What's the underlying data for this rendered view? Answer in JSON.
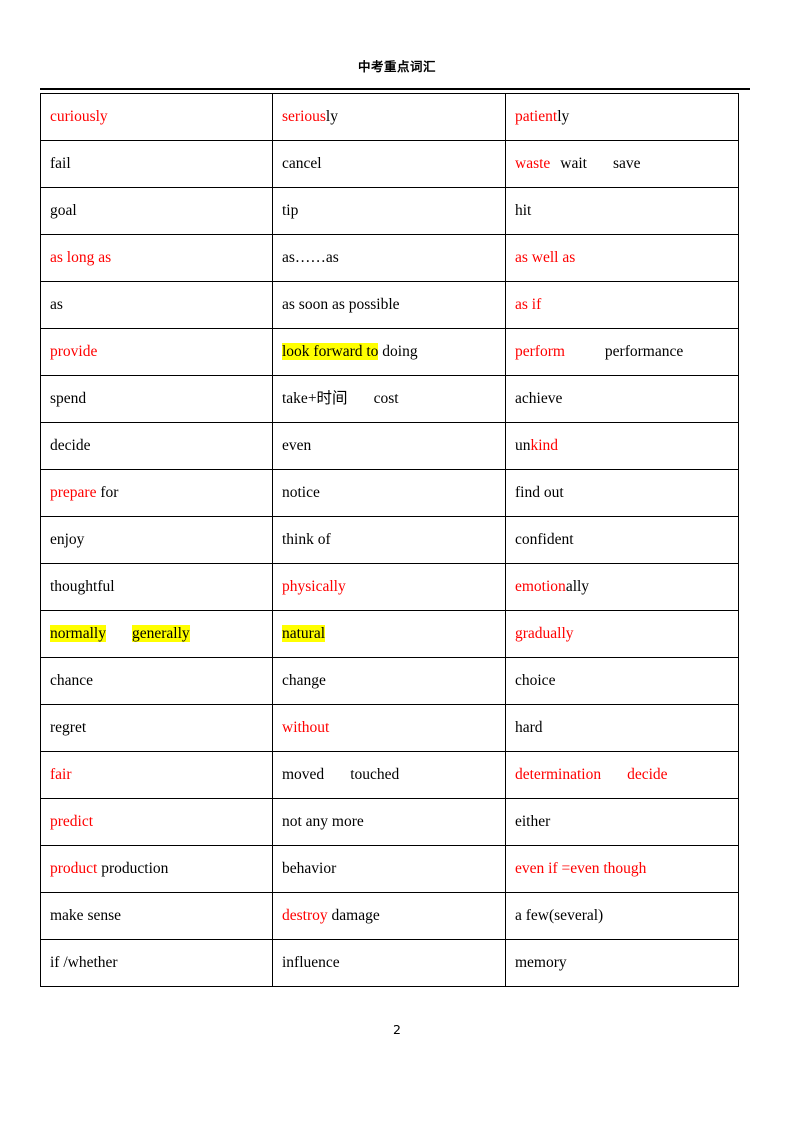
{
  "header": {
    "title": "中考重点词汇"
  },
  "footer": {
    "page_number": "2"
  },
  "colors": {
    "red": "#ff0000",
    "black": "#000000",
    "highlight": "#ffff00",
    "border": "#000000",
    "background": "#ffffff"
  },
  "table": {
    "columns": 3,
    "row_count": 19,
    "rows": [
      {
        "cells": [
          {
            "text": "curiously",
            "segments": [
              {
                "t": "curiously",
                "style": "red"
              }
            ]
          },
          {
            "text": "seriously",
            "segments": [
              {
                "t": "serious",
                "style": "red"
              },
              {
                "t": "ly",
                "style": "black"
              }
            ]
          },
          {
            "text": "patiently",
            "segments": [
              {
                "t": "patient",
                "style": "red"
              },
              {
                "t": "ly",
                "style": "black"
              }
            ]
          }
        ]
      },
      {
        "cells": [
          {
            "text": "fail",
            "segments": [
              {
                "t": "fail",
                "style": "black"
              }
            ]
          },
          {
            "text": "cancel",
            "segments": [
              {
                "t": "cancel",
                "style": "black"
              }
            ]
          },
          {
            "text": "waste  wait    save",
            "segments": [
              {
                "t": "waste",
                "style": "red"
              },
              {
                "t": "gap-sm",
                "style": "gap"
              },
              {
                "t": "wait",
                "style": "black"
              },
              {
                "t": "gap-md",
                "style": "gap"
              },
              {
                "t": "save",
                "style": "black"
              }
            ]
          }
        ]
      },
      {
        "cells": [
          {
            "text": "goal",
            "segments": [
              {
                "t": "goal",
                "style": "black"
              }
            ]
          },
          {
            "text": "tip",
            "segments": [
              {
                "t": "tip",
                "style": "black"
              }
            ]
          },
          {
            "text": "hit",
            "segments": [
              {
                "t": "hit",
                "style": "black"
              }
            ]
          }
        ]
      },
      {
        "cells": [
          {
            "text": "as long as",
            "segments": [
              {
                "t": "as long as",
                "style": "red"
              }
            ]
          },
          {
            "text": "as……as",
            "segments": [
              {
                "t": "as……as",
                "style": "black"
              }
            ]
          },
          {
            "text": "as well as",
            "segments": [
              {
                "t": "as well as",
                "style": "red"
              }
            ]
          }
        ]
      },
      {
        "cells": [
          {
            "text": "as",
            "segments": [
              {
                "t": "as",
                "style": "black"
              }
            ]
          },
          {
            "text": "as soon as possible",
            "segments": [
              {
                "t": "as soon as possible",
                "style": "black"
              }
            ]
          },
          {
            "text": "as if",
            "segments": [
              {
                "t": "as if",
                "style": "red"
              }
            ]
          }
        ]
      },
      {
        "cells": [
          {
            "text": "provide",
            "segments": [
              {
                "t": "provide",
                "style": "red"
              }
            ]
          },
          {
            "text": "look forward to doing",
            "segments": [
              {
                "t": "look forward to",
                "style": "hl"
              },
              {
                "t": " doing",
                "style": "black"
              }
            ]
          },
          {
            "text": "perform     performance",
            "segments": [
              {
                "t": "perform",
                "style": "red"
              },
              {
                "t": "gap-lg",
                "style": "gap"
              },
              {
                "t": "performance",
                "style": "black"
              }
            ]
          }
        ]
      },
      {
        "cells": [
          {
            "text": "spend",
            "segments": [
              {
                "t": "spend",
                "style": "black"
              }
            ]
          },
          {
            "text": "take+时间    cost",
            "segments": [
              {
                "t": "take+时间",
                "style": "black"
              },
              {
                "t": "gap-md",
                "style": "gap"
              },
              {
                "t": "cost",
                "style": "black"
              }
            ]
          },
          {
            "text": "achieve",
            "segments": [
              {
                "t": "achieve",
                "style": "black"
              }
            ]
          }
        ]
      },
      {
        "cells": [
          {
            "text": "decide",
            "segments": [
              {
                "t": "decide",
                "style": "black"
              }
            ]
          },
          {
            "text": "even",
            "segments": [
              {
                "t": "even",
                "style": "black"
              }
            ]
          },
          {
            "text": "unkind",
            "segments": [
              {
                "t": "un",
                "style": "black"
              },
              {
                "t": "kind",
                "style": "red"
              }
            ]
          }
        ]
      },
      {
        "cells": [
          {
            "text": "prepare for",
            "segments": [
              {
                "t": "prepare",
                "style": "red"
              },
              {
                "t": " for",
                "style": "black"
              }
            ]
          },
          {
            "text": "notice",
            "segments": [
              {
                "t": "notice",
                "style": "black"
              }
            ]
          },
          {
            "text": "find out",
            "segments": [
              {
                "t": "find out",
                "style": "black"
              }
            ]
          }
        ]
      },
      {
        "cells": [
          {
            "text": "enjoy",
            "segments": [
              {
                "t": "enjoy",
                "style": "black"
              }
            ]
          },
          {
            "text": "think of",
            "segments": [
              {
                "t": "think of",
                "style": "black"
              }
            ]
          },
          {
            "text": "confident",
            "segments": [
              {
                "t": "confident",
                "style": "black"
              }
            ]
          }
        ]
      },
      {
        "cells": [
          {
            "text": "thoughtful",
            "segments": [
              {
                "t": "thoughtful",
                "style": "black"
              }
            ]
          },
          {
            "text": "physically",
            "segments": [
              {
                "t": "physically",
                "style": "red"
              }
            ]
          },
          {
            "text": "emotionally",
            "segments": [
              {
                "t": "emotion",
                "style": "red"
              },
              {
                "t": "ally",
                "style": "black"
              }
            ]
          }
        ]
      },
      {
        "cells": [
          {
            "text": "normally   generally",
            "segments": [
              {
                "t": "normally",
                "style": "hl"
              },
              {
                "t": "gap-md",
                "style": "gap"
              },
              {
                "t": "generally",
                "style": "hl"
              }
            ]
          },
          {
            "text": "natural",
            "segments": [
              {
                "t": "natural",
                "style": "hl"
              }
            ]
          },
          {
            "text": "gradually",
            "segments": [
              {
                "t": "gradually",
                "style": "red"
              }
            ]
          }
        ]
      },
      {
        "cells": [
          {
            "text": "chance",
            "segments": [
              {
                "t": "chance",
                "style": "black"
              }
            ]
          },
          {
            "text": "change",
            "segments": [
              {
                "t": "change",
                "style": "black"
              }
            ]
          },
          {
            "text": "choice",
            "segments": [
              {
                "t": "choice",
                "style": "black"
              }
            ]
          }
        ]
      },
      {
        "cells": [
          {
            "text": "regret",
            "segments": [
              {
                "t": "regret",
                "style": "black"
              }
            ]
          },
          {
            "text": "without",
            "segments": [
              {
                "t": "without",
                "style": "red"
              }
            ]
          },
          {
            "text": "hard",
            "segments": [
              {
                "t": "hard",
                "style": "black"
              }
            ]
          }
        ]
      },
      {
        "cells": [
          {
            "text": "fair",
            "segments": [
              {
                "t": "fair",
                "style": "red"
              }
            ]
          },
          {
            "text": "moved   touched",
            "segments": [
              {
                "t": "moved",
                "style": "black"
              },
              {
                "t": "gap-md",
                "style": "gap"
              },
              {
                "t": "touched",
                "style": "black"
              }
            ]
          },
          {
            "text": "determination   decide",
            "segments": [
              {
                "t": "determination",
                "style": "red"
              },
              {
                "t": "gap-md",
                "style": "gap"
              },
              {
                "t": "decide",
                "style": "red"
              }
            ]
          }
        ]
      },
      {
        "cells": [
          {
            "text": "predict",
            "segments": [
              {
                "t": "predict",
                "style": "red"
              }
            ]
          },
          {
            "text": "not any more",
            "segments": [
              {
                "t": "not any more",
                "style": "black"
              }
            ]
          },
          {
            "text": "either",
            "segments": [
              {
                "t": "either",
                "style": "black"
              }
            ]
          }
        ]
      },
      {
        "cells": [
          {
            "text": "product production",
            "segments": [
              {
                "t": "product",
                "style": "red"
              },
              {
                "t": " production",
                "style": "black"
              }
            ]
          },
          {
            "text": "behavior",
            "segments": [
              {
                "t": "behavior",
                "style": "black"
              }
            ]
          },
          {
            "text": "even if =even though",
            "segments": [
              {
                "t": "even if =even though",
                "style": "red"
              }
            ]
          }
        ]
      },
      {
        "cells": [
          {
            "text": "make sense",
            "segments": [
              {
                "t": "make sense",
                "style": "black"
              }
            ]
          },
          {
            "text": "destroy damage",
            "segments": [
              {
                "t": "destroy",
                "style": "red"
              },
              {
                "t": " damage",
                "style": "black"
              }
            ]
          },
          {
            "text": "a few(several)",
            "segments": [
              {
                "t": "a few(several)",
                "style": "black"
              }
            ]
          }
        ]
      },
      {
        "cells": [
          {
            "text": "if /whether",
            "segments": [
              {
                "t": "if /whether",
                "style": "black"
              }
            ]
          },
          {
            "text": "influence",
            "segments": [
              {
                "t": "influence",
                "style": "black"
              }
            ]
          },
          {
            "text": "memory",
            "segments": [
              {
                "t": "memory",
                "style": "black"
              }
            ]
          }
        ]
      }
    ]
  }
}
